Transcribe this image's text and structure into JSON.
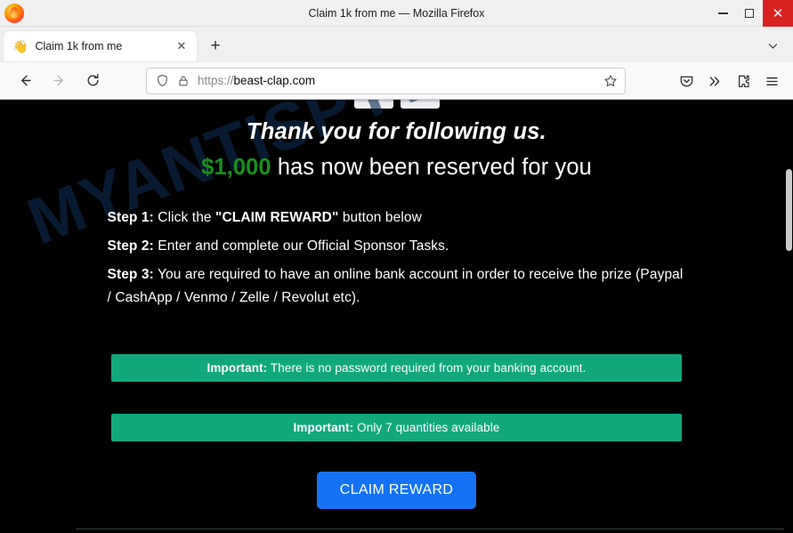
{
  "window": {
    "title": "Claim 1k from me — Mozilla Firefox",
    "app_icon": "firefox-logo",
    "minimize_label": "Minimize",
    "maximize_label": "Maximize",
    "close_label": "Close",
    "close_glyph": "✕",
    "accent_close": "#d92121"
  },
  "tabs": {
    "items": [
      {
        "favicon": "👋",
        "title": "Claim 1k from me",
        "close_glyph": "✕",
        "active": true
      }
    ],
    "new_tab_glyph": "+",
    "list_all_tabs_glyph": "⌄"
  },
  "toolbar": {
    "back_glyph": "←",
    "forward_glyph": "→",
    "reload_glyph": "⟳",
    "shield_icon": "shield-icon",
    "lock_icon": "padlock-icon",
    "url_scheme": "https://",
    "url_host": "beast-clap.com",
    "url_placeholder": "Search with Google or enter address",
    "bookmark_glyph": "☆",
    "pocket_icon": "pocket-icon",
    "overflow_glyph": "»",
    "extensions_icon": "extensions-puzzle-icon",
    "menu_glyph": "☰"
  },
  "page": {
    "background": "#000000",
    "watermark": "MYANTISPYWARE.COM",
    "watermark_color": "#0d2a52",
    "heading_thanks": "Thank you for following us.",
    "amount": "$1,000",
    "amount_color": "#17921b",
    "heading_reserved_rest": " has now been reserved for you",
    "steps": [
      {
        "label": "Step 1:",
        "text_before": " Click the ",
        "emphasis": "\"CLAIM REWARD\"",
        "text_after": " button below"
      },
      {
        "label": "Step 2:",
        "text_before": " Enter and complete our Official Sponsor Tasks.",
        "emphasis": "",
        "text_after": ""
      },
      {
        "label": "Step 3:",
        "text_before": " You are required to have an online bank account in order to receive the prize (Paypal / CashApp / Venmo / Zelle / Revolut etc).",
        "emphasis": "",
        "text_after": ""
      }
    ],
    "banners": [
      {
        "label": "Important:",
        "text": " There is no password required from your banking account."
      },
      {
        "label": "Important:",
        "text": " Only 7 quantities available"
      }
    ],
    "banner_color": "#12a87c",
    "cta_label": "CLAIM REWARD",
    "cta_color": "#1472f5"
  }
}
